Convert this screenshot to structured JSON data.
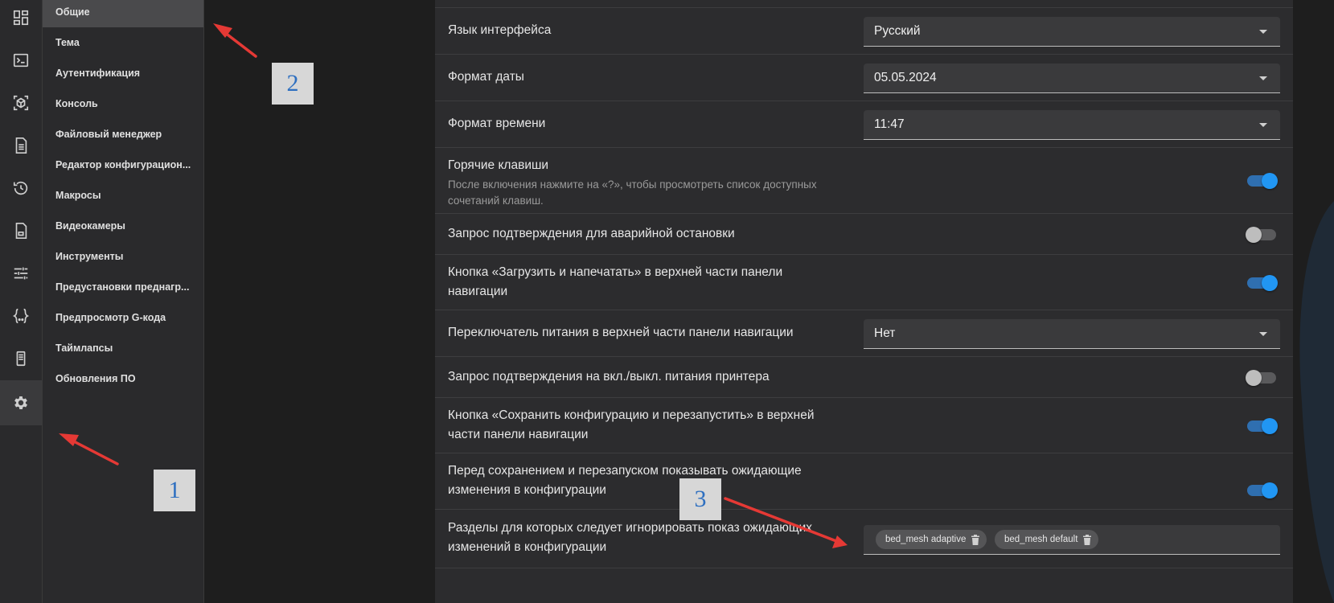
{
  "rail": {
    "icons": [
      "dashboard-icon",
      "console-icon",
      "cube-icon",
      "file-list-icon",
      "history-icon",
      "file-gcode-icon",
      "sliders-icon",
      "braces-icon",
      "device-icon",
      "gear-icon"
    ],
    "active": "gear-icon"
  },
  "subnav": {
    "items": [
      {
        "label": "Общие",
        "active": true
      },
      {
        "label": "Тема"
      },
      {
        "label": "Аутентификация"
      },
      {
        "label": "Консоль"
      },
      {
        "label": "Файловый менеджер"
      },
      {
        "label": "Редактор конфигурацион..."
      },
      {
        "label": "Макросы"
      },
      {
        "label": "Видеокамеры"
      },
      {
        "label": "Инструменты"
      },
      {
        "label": "Предустановки преднагр..."
      },
      {
        "label": "Предпросмотр G-кода"
      },
      {
        "label": "Таймлапсы"
      },
      {
        "label": "Обновления ПО"
      }
    ]
  },
  "settings": {
    "language": {
      "label": "Язык интерфейса",
      "value": "Русский"
    },
    "date_format": {
      "label": "Формат даты",
      "value": "05.05.2024"
    },
    "time_format": {
      "label": "Формат времени",
      "value": "11:47"
    },
    "hotkeys": {
      "label": "Горячие клавиши",
      "sub": "После включения нажмите на «?», чтобы просмотреть список доступных сочетаний клавиш.",
      "on": true
    },
    "estop_confirm": {
      "label": "Запрос подтверждения для аварийной остановки",
      "on": false
    },
    "upload_print_btn": {
      "label": "Кнопка «Загрузить и напечатать» в верхней части панели навигации",
      "on": true
    },
    "power_switch": {
      "label": "Переключатель питания в верхней части панели навигации",
      "value": "Нет"
    },
    "power_confirm": {
      "label": "Запрос подтверждения на вкл./выкл. питания принтера",
      "on": false
    },
    "save_restart_btn": {
      "label": "Кнопка «Сохранить конфигурацию и перезапустить» в верхней части панели навигации",
      "on": true
    },
    "pending_changes": {
      "label": "Перед сохранением и перезапуском показывать ожидающие изменения в конфигурации",
      "on": true
    },
    "ignore_sections": {
      "label": "Разделы для которых следует игнорировать показ ожидающих изменений в конфигурации",
      "chips": [
        "bed_mesh adaptive",
        "bed_mesh default"
      ]
    }
  },
  "annotations": {
    "tag1": "1",
    "tag2": "2",
    "tag3": "3"
  },
  "colors": {
    "accent": "#2196f3",
    "arrow": "#e53935"
  }
}
